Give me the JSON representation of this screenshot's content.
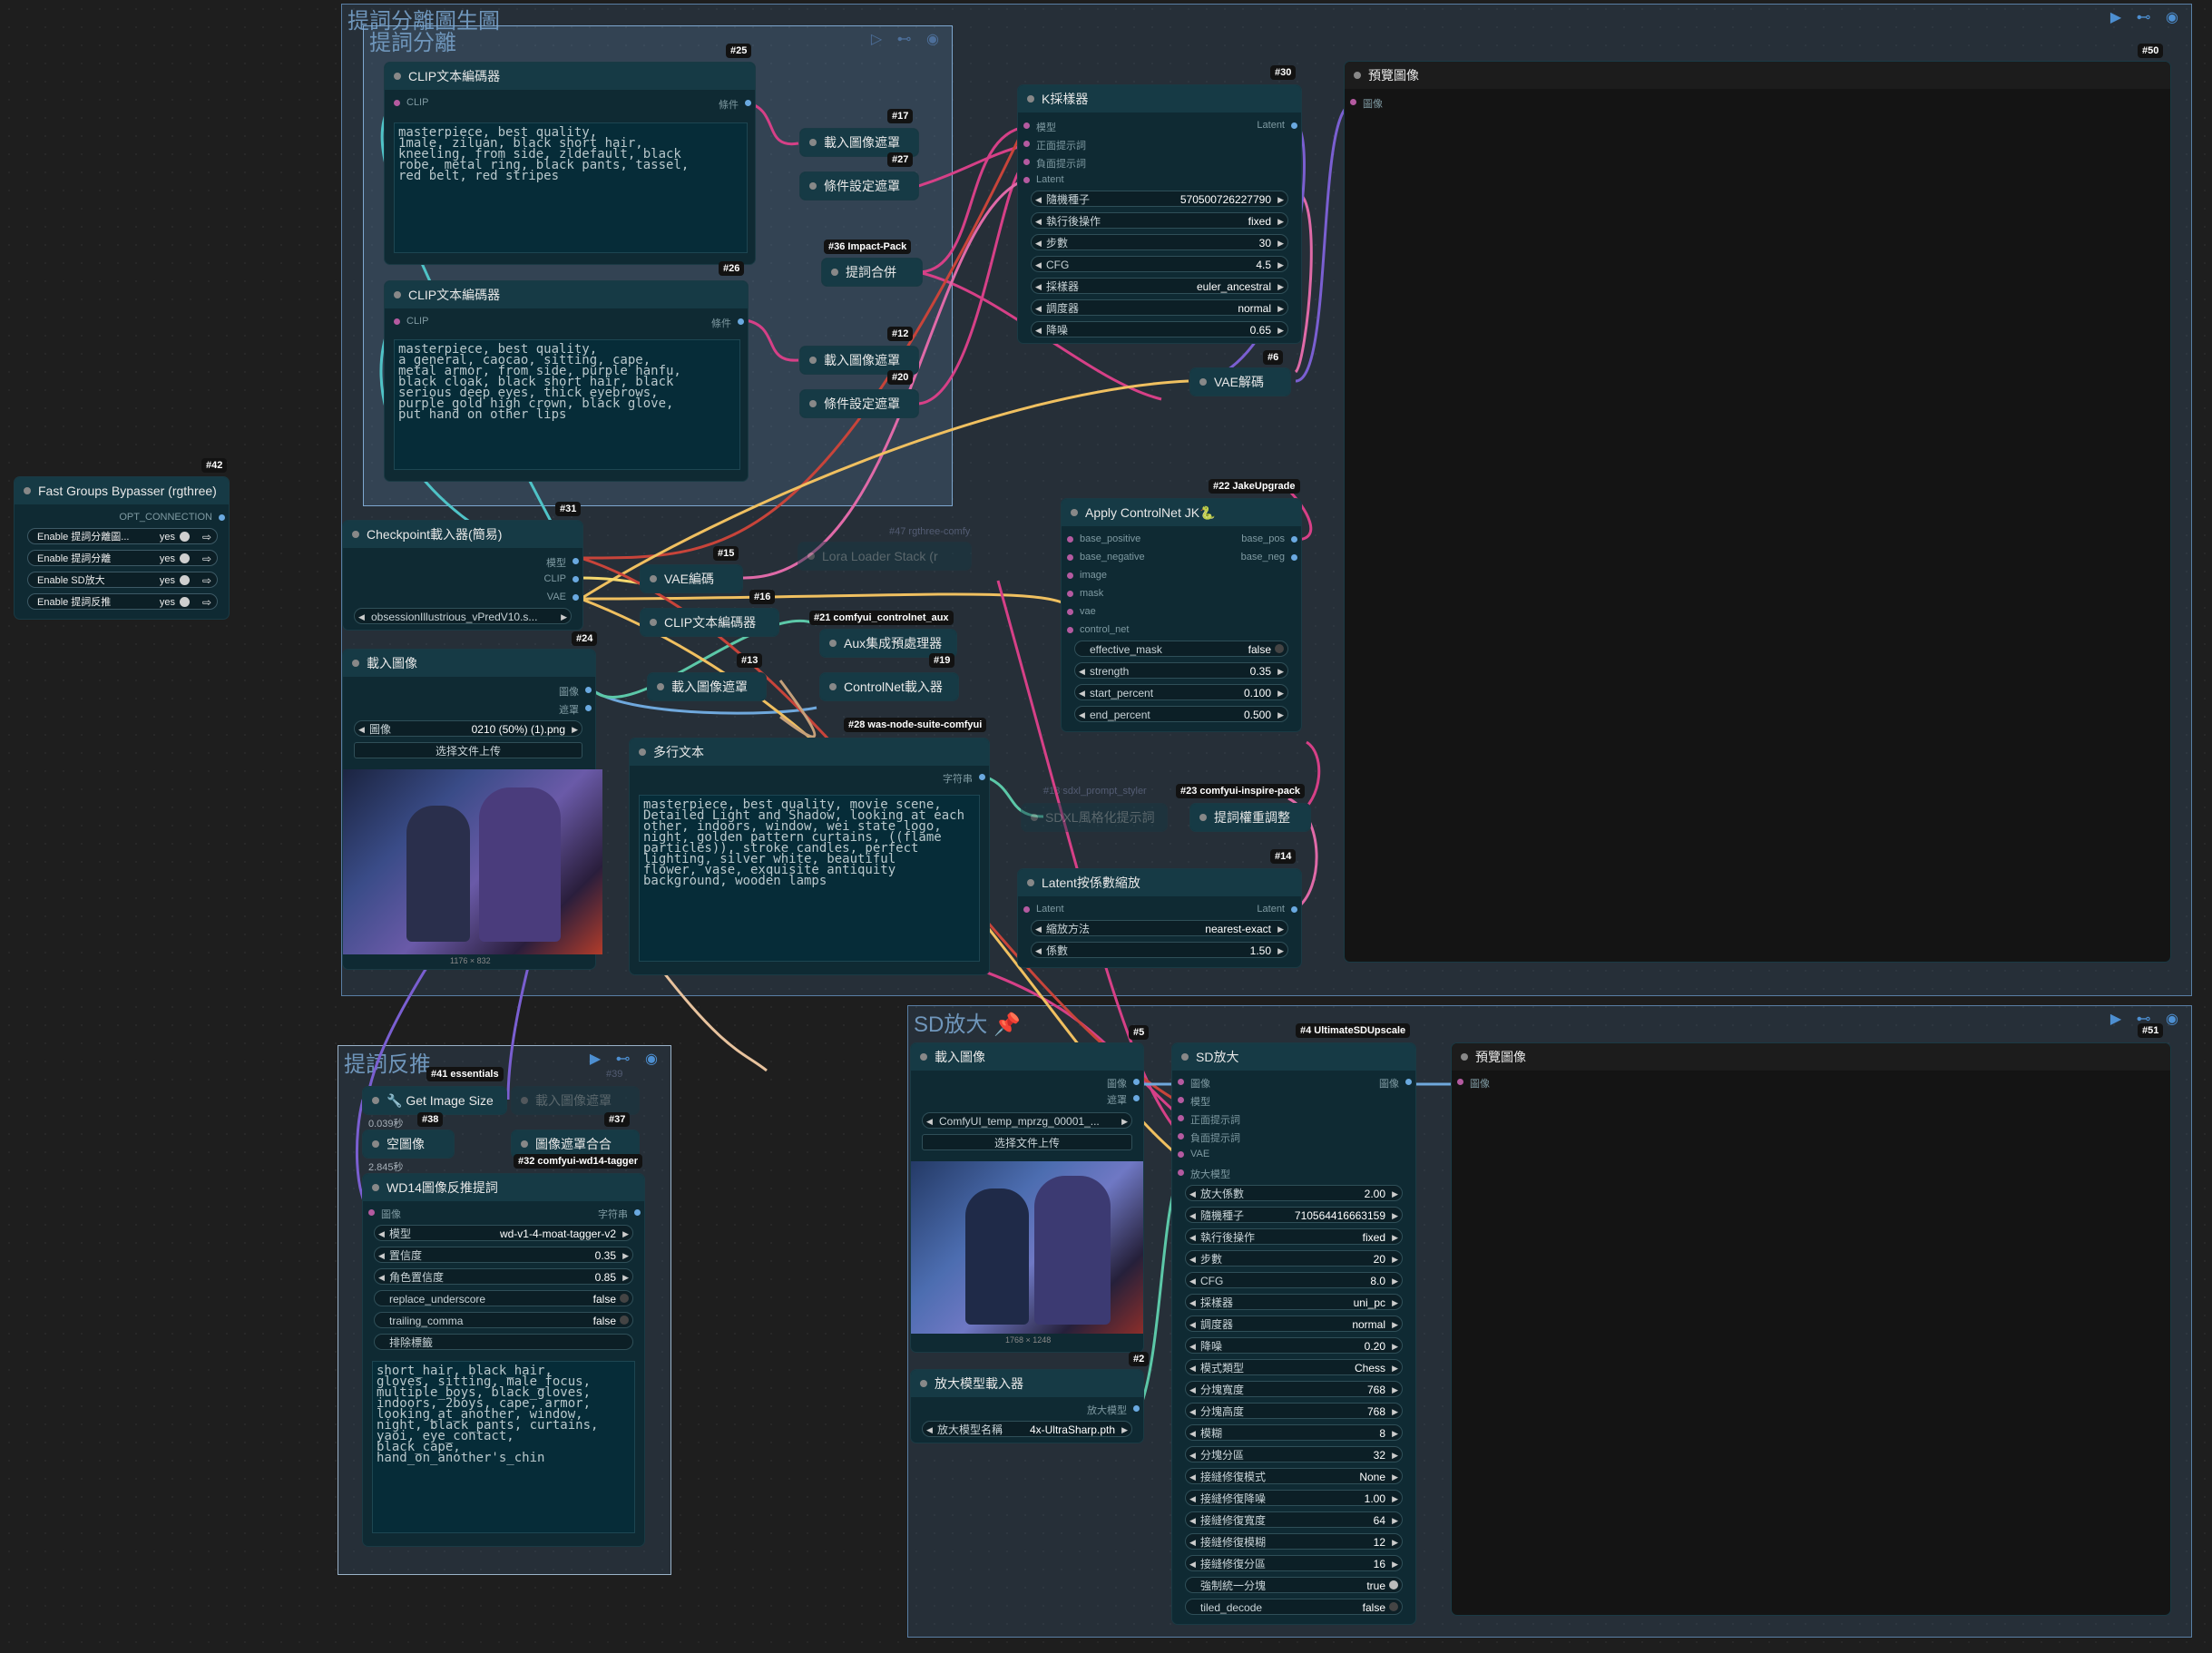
{
  "groups": {
    "main_title": "提詞分離圖生圖",
    "sub_title": "提詞分離",
    "sd_title": "SD放大 📌",
    "reverse_title": "提詞反推"
  },
  "bypasser": {
    "badge": "#42",
    "title": "Fast Groups Bypasser (rgthree)",
    "output": "OPT_CONNECTION",
    "rows": [
      {
        "label": "Enable 提詞分離圖...",
        "value": "yes"
      },
      {
        "label": "Enable 提詞分離",
        "value": "yes"
      },
      {
        "label": "Enable SD放大",
        "value": "yes"
      },
      {
        "label": "Enable 提詞反推",
        "value": "yes"
      }
    ]
  },
  "clip1": {
    "badge": "#25",
    "title": "CLIP文本編碼器",
    "in": "CLIP",
    "out": "條件",
    "text": "masterpiece, best quality,\n1male, ziluan, black short hair,\nkneeling, from side, zldefault, black\nrobe, metal ring, black pants, tassel,\nred belt, red stripes"
  },
  "clip2": {
    "badge": "#26",
    "title": "CLIP文本編碼器",
    "in": "CLIP",
    "out": "條件",
    "text": "masterpiece, best quality,\na general, caocao, sitting, cape,\nmetal armor, from side, purple hanfu,\nblack cloak, black short hair, black\nserious deep eyes, thick eyebrows,\npurple gold high crown, black glove,\nput hand on other lips"
  },
  "mini": {
    "n17": {
      "badge": "#17",
      "title": "載入圖像遮罩"
    },
    "n27": {
      "badge": "#27",
      "title": "條件設定遮罩"
    },
    "n36": {
      "badge": "#36 Impact-Pack",
      "title": "提詞合併"
    },
    "n12": {
      "badge": "#12",
      "title": "載入圖像遮罩"
    },
    "n20": {
      "badge": "#20",
      "title": "條件設定遮罩"
    },
    "n15": {
      "badge": "#15",
      "title": "VAE編碼"
    },
    "n16": {
      "badge": "#16",
      "title": "CLIP文本編碼器"
    },
    "n21": {
      "badge": "#21 comfyui_controlnet_aux",
      "title": "Aux集成預處理器"
    },
    "n13": {
      "badge": "#13",
      "title": "載入圖像遮罩"
    },
    "n19": {
      "badge": "#19",
      "title": "ControlNet載入器"
    },
    "n6": {
      "badge": "#6",
      "title": "VAE解碼"
    },
    "n47": {
      "badge": "#47 rgthree-comfy",
      "title": "Lora Loader Stack (r"
    },
    "n18": {
      "badge": "#18 sdxl_prompt_styler",
      "title": "SDXL風格化提示詞"
    },
    "n23": {
      "badge": "#23 comfyui-inspire-pack",
      "title": "提詞權重調整"
    }
  },
  "ksampler": {
    "badge": "#30",
    "title": "K採樣器",
    "inputs": [
      "模型",
      "正面提示詞",
      "負面提示詞",
      "Latent"
    ],
    "output": "Latent",
    "widgets": [
      {
        "label": "隨機種子",
        "value": "570500726227790"
      },
      {
        "label": "執行後操作",
        "value": "fixed"
      },
      {
        "label": "步數",
        "value": "30"
      },
      {
        "label": "CFG",
        "value": "4.5"
      },
      {
        "label": "採樣器",
        "value": "euler_ancestral"
      },
      {
        "label": "調度器",
        "value": "normal"
      },
      {
        "label": "降噪",
        "value": "0.65"
      }
    ]
  },
  "preview1": {
    "badge": "#50",
    "title": "預覽圖像",
    "in": "圖像"
  },
  "checkpoint": {
    "badge": "#31",
    "title": "Checkpoint載入器(簡易)",
    "outputs": [
      "模型",
      "CLIP",
      "VAE"
    ],
    "value": "obsessionIllustrious_vPredV10.s..."
  },
  "loadimg": {
    "badge": "#24",
    "title": "載入圖像",
    "outputs": [
      "圖像",
      "遮罩"
    ],
    "value": "0210 (50%) (1).png",
    "label": "圖像",
    "upload": "选择文件上传",
    "caption": "1176 × 832"
  },
  "controlnet": {
    "badge": "#22 JakeUpgrade",
    "title": "Apply ControlNet JK🐍",
    "inputs": [
      "base_positive",
      "base_negative",
      "image",
      "mask",
      "vae",
      "control_net"
    ],
    "outputs": [
      "base_pos",
      "base_neg"
    ],
    "toggle": {
      "label": "effective_mask",
      "value": "false"
    },
    "widgets": [
      {
        "label": "strength",
        "value": "0.35"
      },
      {
        "label": "start_percent",
        "value": "0.100"
      },
      {
        "label": "end_percent",
        "value": "0.500"
      }
    ]
  },
  "multiline": {
    "badge": "#28 was-node-suite-comfyui",
    "title": "多行文本",
    "out": "字符串",
    "text": "masterpiece, best quality, movie scene,\nDetailed Light and Shadow, looking at each\nother, indoors, window, wei state logo,\nnight, golden pattern curtains, ((flame\nparticles)), stroke candles, perfect\nlighting, silver white, beautiful\nflower, vase, exquisite antiquity\nbackground, wooden lamps"
  },
  "latentscale": {
    "badge": "#14",
    "title": "Latent按係數縮放",
    "in": "Latent",
    "out": "Latent",
    "widgets": [
      {
        "label": "縮放方法",
        "value": "nearest-exact"
      },
      {
        "label": "係數",
        "value": "1.50"
      }
    ]
  },
  "reverse": {
    "n41": {
      "badge": "#41 essentials",
      "title": "🔧 Get Image Size"
    },
    "n38": {
      "badge": "#38",
      "title": "空圖像",
      "time": "2.845秒"
    },
    "n39": {
      "badge": "#39",
      "title": "載入圖像遮罩"
    },
    "n37": {
      "badge": "#37",
      "title": "圖像遮罩合合"
    },
    "time1": "0.039秒",
    "n32badge": "#32 comfyui-wd14-tagger",
    "wd14": {
      "title": "WD14圖像反推提詞",
      "in": "圖像",
      "out": "字符串",
      "widgets": [
        {
          "label": "模型",
          "value": "wd-v1-4-moat-tagger-v2"
        },
        {
          "label": "置信度",
          "value": "0.35"
        },
        {
          "label": "角色置信度",
          "value": "0.85"
        }
      ],
      "toggles": [
        {
          "label": "replace_underscore",
          "value": "false"
        },
        {
          "label": "trailing_comma",
          "value": "false"
        }
      ],
      "exclude": "排除標籤",
      "text": "short_hair, black_hair,\ngloves, sitting, male_focus,\nmultiple_boys, black_gloves,\nindoors, 2boys, cape, armor,\nlooking_at_another, window,\nnight, black_pants, curtains,\nyaoi, eye_contact,\nblack_cape,\nhand_on_another's_chin"
    }
  },
  "sd": {
    "loadimg": {
      "badge": "#5",
      "title": "載入圖像",
      "outputs": [
        "圖像",
        "遮罩"
      ],
      "value": "ComfyUI_temp_mprzg_00001_...",
      "upload": "选择文件上传",
      "caption": "1768 × 1248"
    },
    "upscaler_loader": {
      "badge": "#2",
      "title": "放大模型載入器",
      "out": "放大模型",
      "label": "放大模型名稱",
      "value": "4x-UltraSharp.pth"
    },
    "upscale": {
      "badge": "#4 UltimateSDUpscale",
      "title": "SD放大",
      "inputs": [
        "圖像",
        "模型",
        "正面提示詞",
        "負面提示詞",
        "VAE",
        "放大模型"
      ],
      "out": "圖像",
      "widgets": [
        {
          "label": "放大係數",
          "value": "2.00"
        },
        {
          "label": "隨機種子",
          "value": "710564416663159"
        },
        {
          "label": "執行後操作",
          "value": "fixed"
        },
        {
          "label": "步數",
          "value": "20"
        },
        {
          "label": "CFG",
          "value": "8.0"
        },
        {
          "label": "採樣器",
          "value": "uni_pc"
        },
        {
          "label": "調度器",
          "value": "normal"
        },
        {
          "label": "降噪",
          "value": "0.20"
        },
        {
          "label": "模式類型",
          "value": "Chess"
        },
        {
          "label": "分塊寬度",
          "value": "768"
        },
        {
          "label": "分塊高度",
          "value": "768"
        },
        {
          "label": "模糊",
          "value": "8"
        },
        {
          "label": "分塊分區",
          "value": "32"
        },
        {
          "label": "接縫修復模式",
          "value": "None"
        },
        {
          "label": "接縫修復降噪",
          "value": "1.00"
        },
        {
          "label": "接縫修復寬度",
          "value": "64"
        },
        {
          "label": "接縫修復模糊",
          "value": "12"
        },
        {
          "label": "接縫修復分區",
          "value": "16"
        }
      ],
      "toggles": [
        {
          "label": "強制統一分塊",
          "value": "true"
        },
        {
          "label": "tiled_decode",
          "value": "false"
        }
      ]
    },
    "preview": {
      "badge": "#51",
      "title": "預覽圖像",
      "in": "圖像"
    }
  }
}
